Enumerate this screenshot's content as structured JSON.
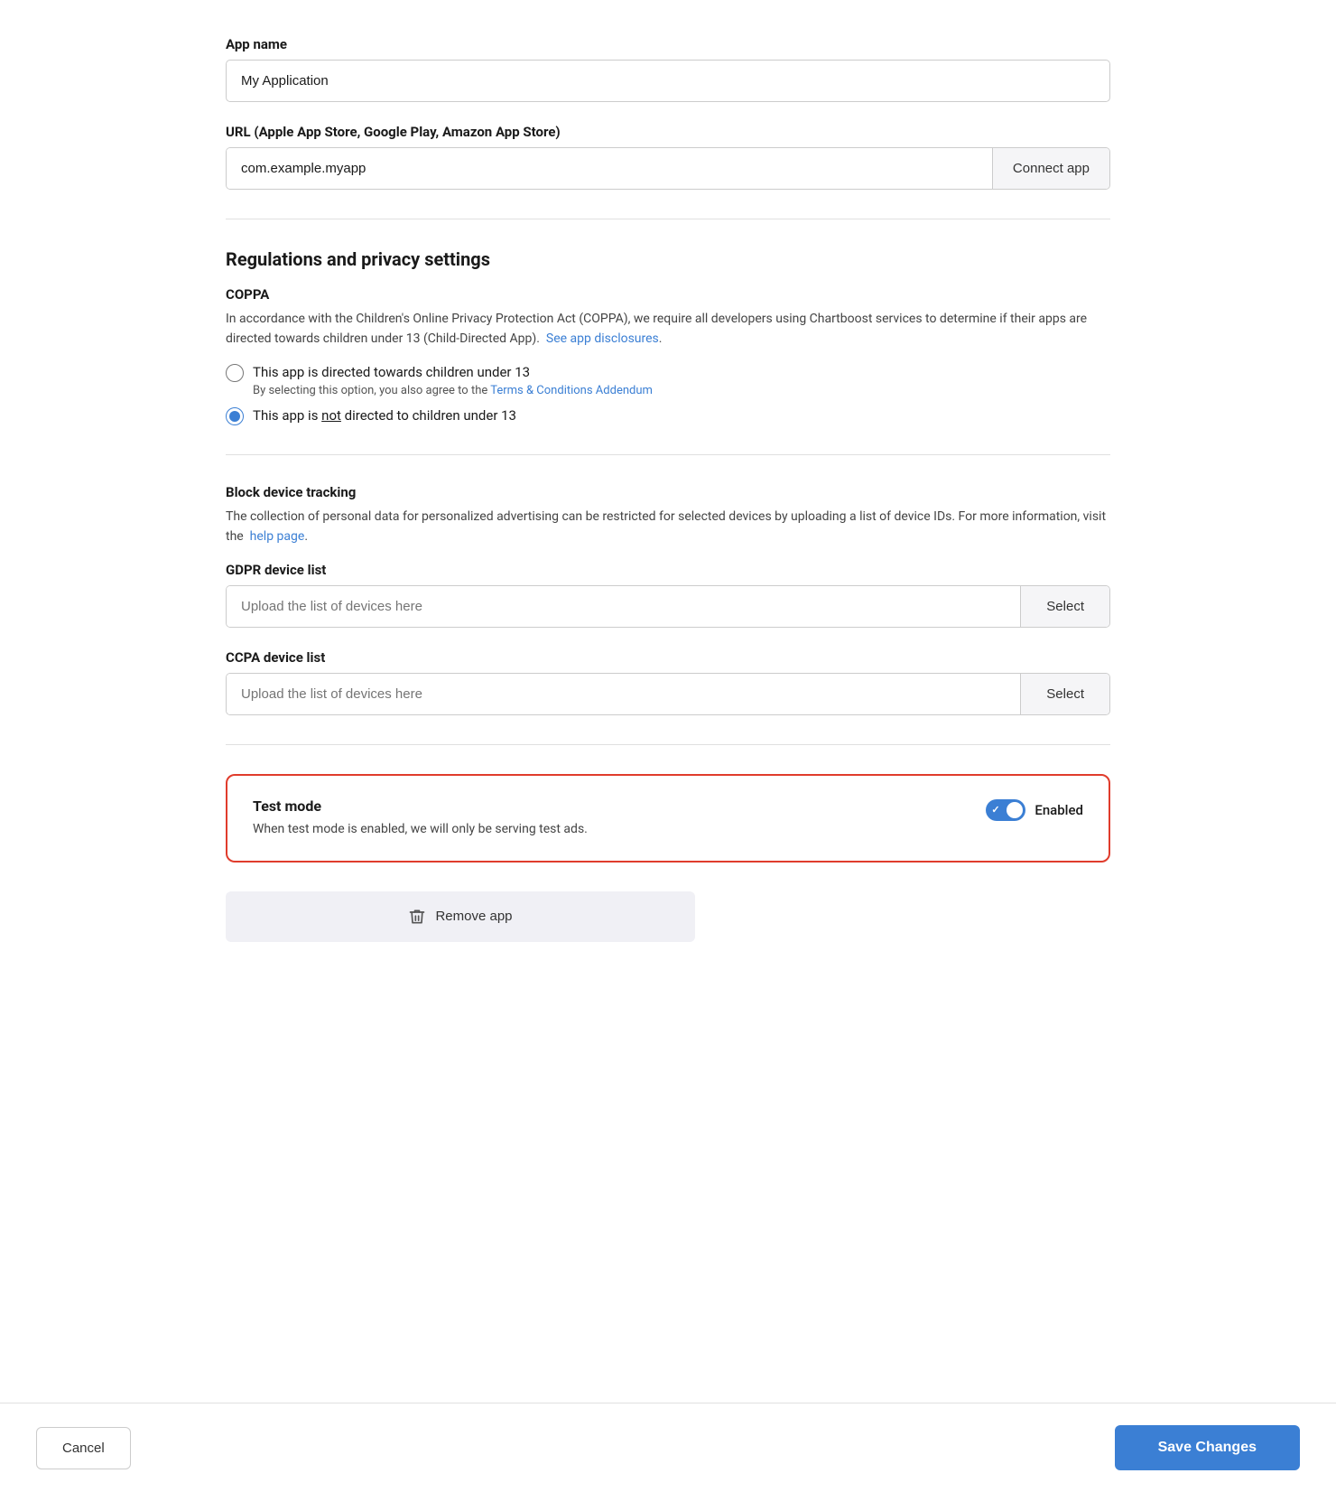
{
  "appName": {
    "label": "App name",
    "value": "My Application",
    "placeholder": "My Application"
  },
  "urlField": {
    "label": "URL (Apple App Store, Google Play, Amazon App Store)",
    "value": "com.example.myapp",
    "placeholder": "com.example.myapp",
    "connectButton": "Connect app"
  },
  "regulations": {
    "sectionTitle": "Regulations and privacy settings",
    "coppa": {
      "subsectionTitle": "COPPA",
      "description": "In accordance with the Children's Online Privacy Protection Act (COPPA), we require all developers using Chartboost services to determine if their apps are directed towards children under 13 (Child-Directed App).",
      "seeDisclosuresLink": "See app disclosures",
      "radio1": {
        "label": "This app is directed towards children under 13",
        "sublabel": "By selecting this option, you also agree to the",
        "sublabelLink": "Terms & Conditions Addendum",
        "selected": false
      },
      "radio2": {
        "label_before": "This app is ",
        "label_not": "not",
        "label_after": " directed to children under 13",
        "selected": true
      }
    },
    "blockTracking": {
      "subsectionTitle": "Block device tracking",
      "description": "The collection of personal data for personalized advertising can be restricted for selected devices by uploading a list of device IDs. For more information, visit the",
      "helpPageLink": "help page"
    },
    "gdpr": {
      "label": "GDPR device list",
      "placeholder": "Upload the list of devices here",
      "selectButton": "Select"
    },
    "ccpa": {
      "label": "CCPA device list",
      "placeholder": "Upload the list of devices here",
      "selectButton": "Select"
    }
  },
  "testMode": {
    "title": "Test mode",
    "description": "When test mode is enabled, we will only be serving test ads.",
    "toggleLabel": "Enabled",
    "enabled": true
  },
  "removeApp": {
    "label": "Remove app"
  },
  "footer": {
    "cancelLabel": "Cancel",
    "saveLabel": "Save Changes"
  }
}
